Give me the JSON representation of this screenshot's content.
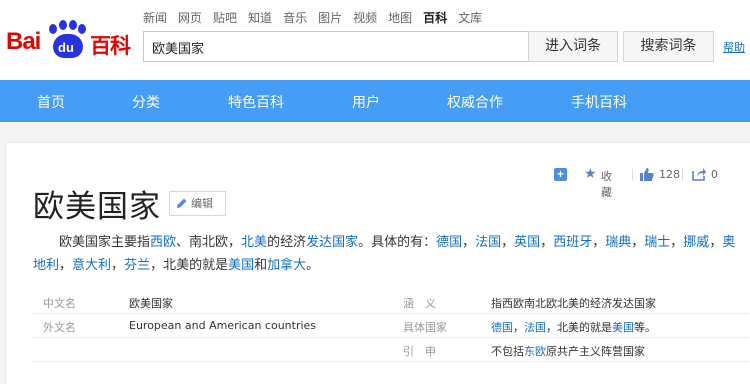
{
  "brand": {
    "logo_left": "Bai",
    "logo_paw": "du",
    "logo_right": "百科"
  },
  "topnav": [
    "新闻",
    "网页",
    "贴吧",
    "知道",
    "音乐",
    "图片",
    "视频",
    "地图",
    "百科",
    "文库"
  ],
  "topnav_active": "百科",
  "search": {
    "value": "欧美国家",
    "enter_label": "进入词条",
    "search_label": "搜索词条",
    "help_label": "帮助"
  },
  "navbar": [
    "首页",
    "分类",
    "特色百科",
    "用户",
    "权威合作",
    "手机百科"
  ],
  "article": {
    "title": "欧美国家",
    "edit_label": "编辑",
    "favorite_label": "收藏",
    "likes": "128",
    "shares": "0",
    "summary": [
      {
        "t": "欧美国家主要指"
      },
      {
        "t": "西欧",
        "link": true
      },
      {
        "t": "、南北欧，"
      },
      {
        "t": "北美",
        "link": true
      },
      {
        "t": "的经济"
      },
      {
        "t": "发达国家",
        "link": true
      },
      {
        "t": "。具体的有："
      },
      {
        "t": "德国",
        "link": true
      },
      {
        "t": "，"
      },
      {
        "t": "法国",
        "link": true
      },
      {
        "t": "，"
      },
      {
        "t": "英国",
        "link": true
      },
      {
        "t": "，"
      },
      {
        "t": "西班牙",
        "link": true
      },
      {
        "t": "，"
      },
      {
        "t": "瑞典",
        "link": true
      },
      {
        "t": "，"
      },
      {
        "t": "瑞士",
        "link": true
      },
      {
        "t": "，"
      },
      {
        "t": "挪威",
        "link": true
      },
      {
        "t": "，"
      },
      {
        "t": "奥地利",
        "link": true
      },
      {
        "t": "，"
      },
      {
        "t": "意大利",
        "link": true
      },
      {
        "t": "，"
      },
      {
        "t": "芬兰",
        "link": true
      },
      {
        "t": "，北美的就是"
      },
      {
        "t": "美国",
        "link": true
      },
      {
        "t": "和"
      },
      {
        "t": "加拿大",
        "link": true
      },
      {
        "t": "。"
      }
    ],
    "info": [
      {
        "k1": "中文名",
        "v1": [
          {
            "t": "欧美国家"
          }
        ],
        "k2": "涵　义",
        "v2": [
          {
            "t": "指西欧南北欧北美的经济发达国家"
          }
        ]
      },
      {
        "k1": "外文名",
        "v1": [
          {
            "t": "European and American countries"
          }
        ],
        "k2": "具体国家",
        "v2": [
          {
            "t": "德国",
            "link": true
          },
          {
            "t": "，"
          },
          {
            "t": "法国",
            "link": true
          },
          {
            "t": "，北美的就是"
          },
          {
            "t": "美国",
            "link": true
          },
          {
            "t": "等。"
          }
        ]
      },
      {
        "k1": "",
        "v1": [],
        "k2": "引　申",
        "v2": [
          {
            "t": "不包括"
          },
          {
            "t": "东欧",
            "link": true
          },
          {
            "t": "原共产主义阵营国家"
          }
        ]
      }
    ]
  },
  "colors": {
    "brand_red": "#e10602",
    "brand_blue": "#2932e1",
    "nav_blue": "#459df5",
    "link": "#136ec2"
  }
}
